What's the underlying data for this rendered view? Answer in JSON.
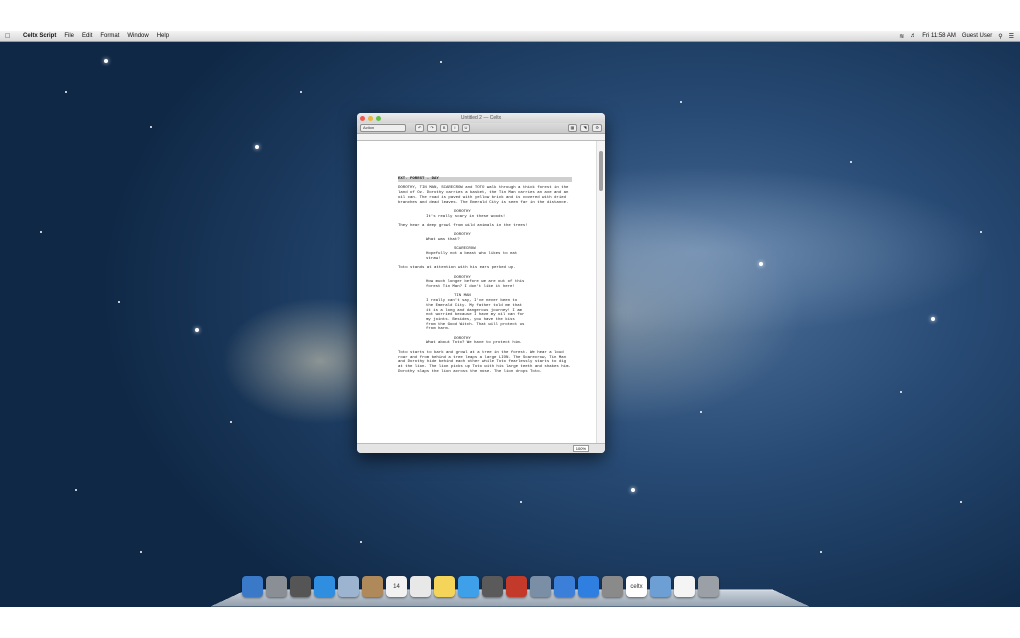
{
  "menubar": {
    "app_name": "Celtx Script",
    "items": [
      "File",
      "Edit",
      "Format",
      "Window",
      "Help"
    ],
    "clock": "Fri 11:58 AM",
    "user": "Guest User"
  },
  "window": {
    "title": "Untitled 2 — Celtx",
    "toolbar": {
      "mode_select": "Action"
    },
    "zoom": "100%"
  },
  "script": {
    "slugline": "EXT. FOREST - DAY",
    "blocks": [
      {
        "type": "action",
        "text": "DOROTHY, TIN MAN, SCARECROW and TOTO walk through a thick forest in the land of Oz. Dorothy carries a basket, the Tin Man carries an axe and an oil can. The road is paved with yellow brick and is covered with dried branches and dead leaves. The Emerald City is seen far in the distance."
      },
      {
        "type": "character",
        "text": "DOROTHY"
      },
      {
        "type": "dialogue",
        "text": "It's really scary in these woods!"
      },
      {
        "type": "action",
        "text": "They hear a deep growl from wild animals in the trees!"
      },
      {
        "type": "character",
        "text": "DOROTHY"
      },
      {
        "type": "dialogue",
        "text": "What was that?"
      },
      {
        "type": "character",
        "text": "SCARECROW"
      },
      {
        "type": "dialogue",
        "text": "Hopefully not a beast who likes to eat straw!"
      },
      {
        "type": "action",
        "text": "Toto stands at attention with his ears perked up."
      },
      {
        "type": "character",
        "text": "DOROTHY"
      },
      {
        "type": "dialogue",
        "text": "How much longer before we are out of this forest Tin Man? I don't like it here!"
      },
      {
        "type": "character",
        "text": "TIN MAN"
      },
      {
        "type": "dialogue",
        "text": "I really can't say, I've never been to the Emerald City. My father told me that it is a long and dangerous journey! I am not worried because I have my oil can for my joints. Besides, you have the kiss from the Good Witch. That will protect us from harm."
      },
      {
        "type": "character",
        "text": "DOROTHY"
      },
      {
        "type": "dialogue",
        "text": "What about Toto? We have to protect him."
      },
      {
        "type": "action",
        "text": "Toto starts to bark and growl at a tree in the forest. We hear a loud roar and from behind a tree leaps a large LION. The Scarecrow, Tin Man and Dorothy hide behind each other while Toto fearlessly starts to dig at the lion. The lion picks up Toto with his large teeth and shakes him. Dorothy slaps the lion across the nose. The lion drops Toto."
      }
    ]
  },
  "dock": {
    "apps": [
      {
        "name": "finder-icon",
        "color": "#3a78c8"
      },
      {
        "name": "launchpad-icon",
        "color": "#8a8f96"
      },
      {
        "name": "mission-control-icon",
        "color": "#555"
      },
      {
        "name": "safari-icon",
        "color": "#2f8ee0"
      },
      {
        "name": "mail-icon",
        "color": "#9db4d0"
      },
      {
        "name": "contacts-icon",
        "color": "#b0895a"
      },
      {
        "name": "calendar-icon",
        "color": "#f2f2f2",
        "label": "14"
      },
      {
        "name": "reminders-icon",
        "color": "#e8e8e8"
      },
      {
        "name": "notes-icon",
        "color": "#f4d55a"
      },
      {
        "name": "messages-icon",
        "color": "#3ea0e8"
      },
      {
        "name": "facetime-icon",
        "color": "#5a5a5a"
      },
      {
        "name": "photo-booth-icon",
        "color": "#c33a2a"
      },
      {
        "name": "iphoto-icon",
        "color": "#7a8fa5"
      },
      {
        "name": "itunes-icon",
        "color": "#3c7fd8"
      },
      {
        "name": "app-store-icon",
        "color": "#2f7fe0"
      },
      {
        "name": "system-preferences-icon",
        "color": "#8a8a8a"
      },
      {
        "name": "celtx-icon",
        "color": "#ffffff",
        "label": "celtx"
      },
      {
        "name": "applications-folder-icon",
        "color": "#6d9ed4"
      },
      {
        "name": "document-icon",
        "color": "#f4f4f4"
      },
      {
        "name": "trash-icon",
        "color": "#9aa0a6"
      }
    ]
  }
}
